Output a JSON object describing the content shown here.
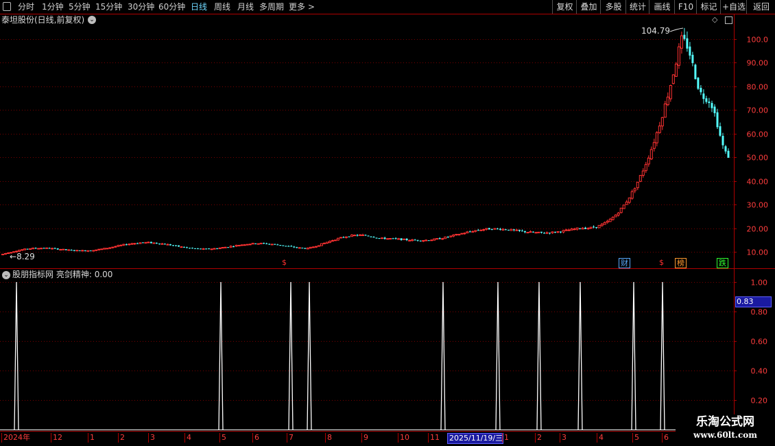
{
  "toolbar": {
    "periods": [
      "分时",
      "1分钟",
      "5分钟",
      "15分钟",
      "30分钟",
      "60分钟",
      "日线",
      "周线",
      "月线",
      "多周期",
      "更多 >"
    ],
    "active_period": "日线",
    "actions": [
      "复权",
      "叠加",
      "多股",
      "统计",
      "画线",
      "F10",
      "标记",
      "+自选",
      "返回"
    ]
  },
  "main_chart": {
    "title": "泰坦股份(日线,前复权)",
    "high_label": "104.79",
    "low_label": "8.29",
    "y_ticks": [
      "100.0",
      "90.00",
      "80.00",
      "70.00",
      "60.00",
      "50.00",
      "40.00",
      "30.00",
      "20.00",
      "10.00"
    ],
    "markers": [
      {
        "text": "$",
        "color": "#ff3030"
      },
      {
        "text": "财",
        "color": "#5aaaff"
      },
      {
        "text": "$",
        "color": "#ff3030"
      },
      {
        "text": "榜",
        "color": "#ff9a30"
      },
      {
        "text": "跌",
        "color": "#30ff30"
      }
    ]
  },
  "indicator": {
    "title": "股朋指标网",
    "line_name": "亮剑精神",
    "line_value": "0.00",
    "y_ticks": [
      "1.00",
      "0.80",
      "0.60",
      "0.40",
      "0.20"
    ],
    "current_value": "0.83"
  },
  "x_axis": {
    "labels": [
      "2024年",
      "12",
      "1",
      "2",
      "3",
      "4",
      "5",
      "6",
      "7",
      "8",
      "9",
      "10",
      "11",
      "2025/11/19/三",
      "1",
      "2",
      "3",
      "4",
      "5",
      "6"
    ]
  },
  "watermark": {
    "name": "乐淘公式网",
    "url": "www.60lt.com"
  },
  "colors": {
    "up": "#ff3232",
    "down": "#54ffff",
    "axis": "#b00000",
    "grid": "#7a0000",
    "spike": "#ffffff"
  },
  "chart_data": {
    "type": "candlestick",
    "price_axis": {
      "min": 5,
      "max": 110,
      "ticks": [
        10,
        20,
        30,
        40,
        50,
        60,
        70,
        80,
        90,
        100
      ]
    },
    "highest": 104.79,
    "lowest": 8.29,
    "indicator_axis": {
      "min": 0,
      "max": 1.0,
      "ticks": [
        0.2,
        0.4,
        0.6,
        0.8,
        1.0
      ]
    },
    "signal_count": 11
  }
}
